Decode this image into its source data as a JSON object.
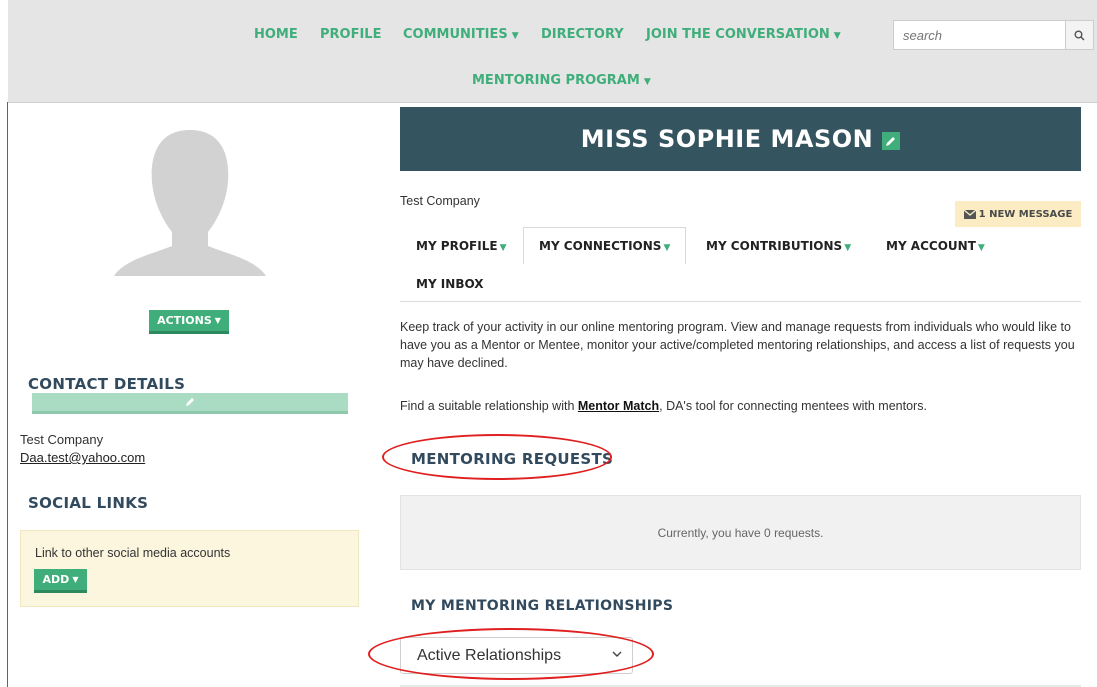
{
  "nav": {
    "home": "HOME",
    "profile": "PROFILE",
    "communities": "COMMUNITIES",
    "directory": "DIRECTORY",
    "join": "JOIN THE CONVERSATION",
    "mentoring": "MENTORING PROGRAM",
    "search_placeholder": "search",
    "search_icon": "search-icon"
  },
  "sidebar": {
    "actions_label": "ACTIONS",
    "contact_title": "CONTACT DETAILS",
    "company": "Test Company",
    "email": "Daa.test@yahoo.com",
    "social_title": "SOCIAL LINKS",
    "social_text": "Link to other social media accounts",
    "add_label": "ADD"
  },
  "profile": {
    "name": "MISS SOPHIE MASON",
    "company": "Test Company",
    "new_message": "1 NEW MESSAGE"
  },
  "tabs": {
    "my_profile": "MY PROFILE",
    "my_connections": "MY CONNECTIONS",
    "my_contributions": "MY CONTRIBUTIONS",
    "my_account": "MY ACCOUNT",
    "my_inbox": "MY INBOX"
  },
  "content": {
    "intro": "Keep track of your activity in our online mentoring program. View and manage requests from individuals who would like to have you as a Mentor or Mentee, monitor your active/completed mentoring relationships, and access a list of requests you may have declined.",
    "find_prefix": "Find a suitable relationship with ",
    "mentor_match": "Mentor Match",
    "find_suffix": ", DA's tool for connecting mentees with mentors.",
    "requests_title": "MENTORING REQUESTS",
    "requests_empty": "Currently, you have 0 requests.",
    "relationships_title": "MY MENTORING RELATIONSHIPS",
    "relationship_filter": "Active Relationships"
  },
  "colors": {
    "accent_green": "#3fae7a",
    "banner": "#34545f",
    "annotation_red": "#e02020"
  }
}
